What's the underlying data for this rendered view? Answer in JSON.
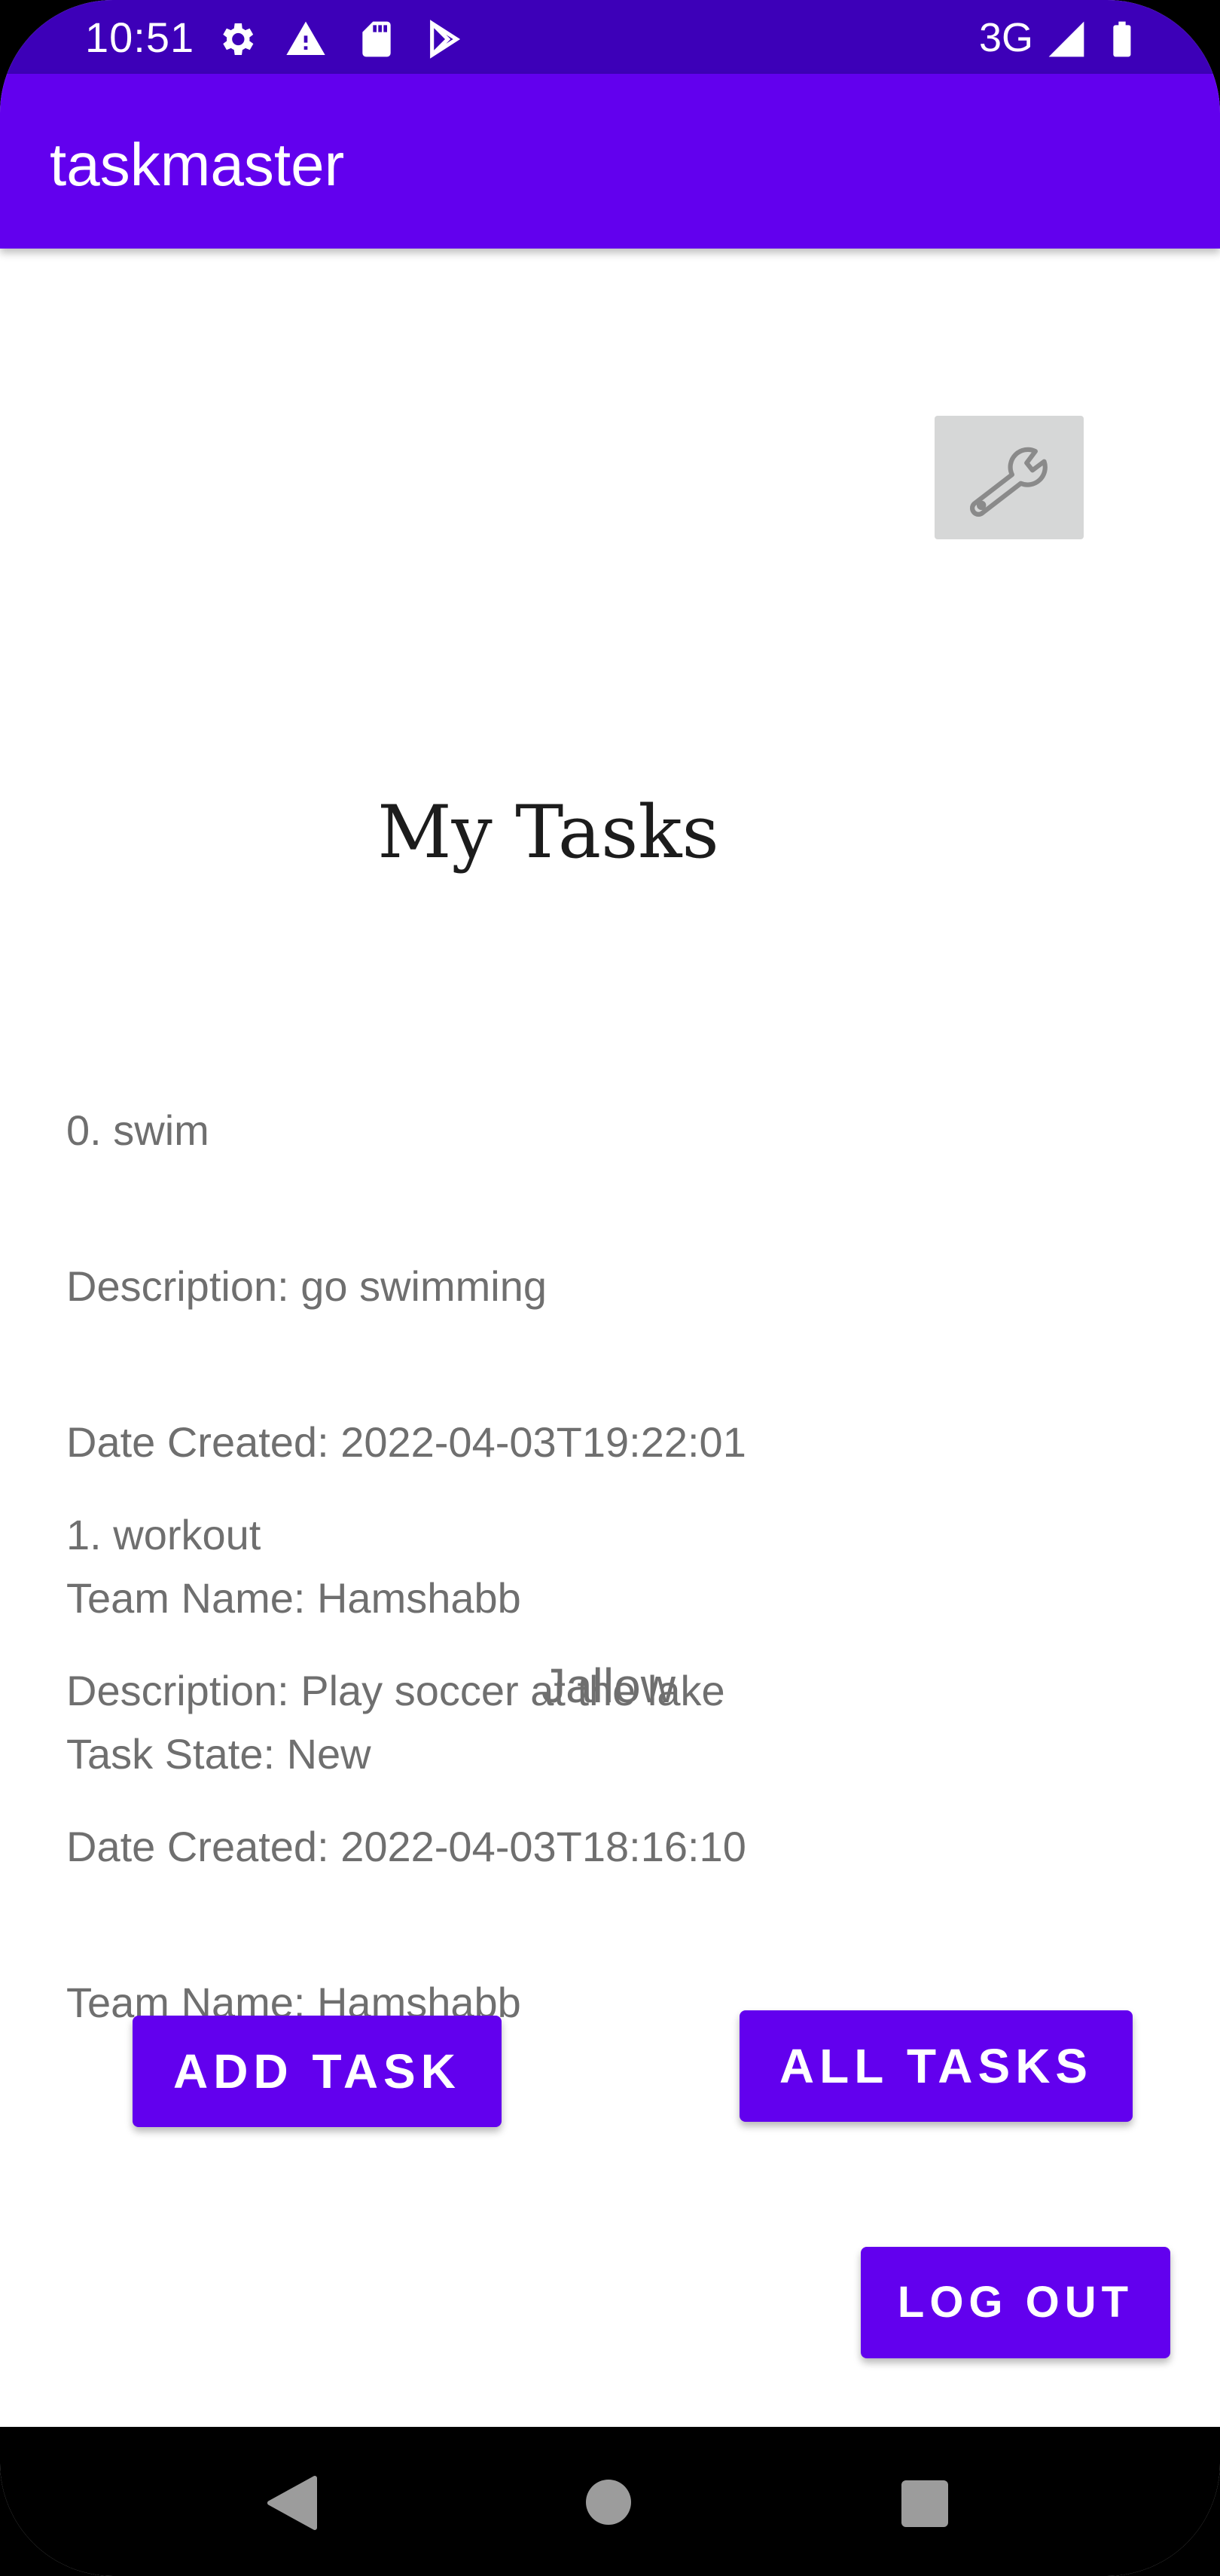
{
  "status_bar": {
    "time": "10:51",
    "network": "3G",
    "icons": [
      "settings-icon",
      "warning-icon",
      "sd-card-icon",
      "play-store-icon",
      "signal-icon",
      "battery-icon"
    ]
  },
  "app_bar": {
    "title": "taskmaster",
    "color": "#6200ee"
  },
  "settings": {
    "icon": "wrench-icon"
  },
  "main": {
    "title": "My Tasks",
    "tasks": [
      {
        "title": "0. swim",
        "description": "Description: go swimming",
        "date": "Date Created: 2022-04-03T19:22:01",
        "team": "Team Name: Hamshabb",
        "state": "Task State: New"
      },
      {
        "title": "1. workout",
        "description": "Description: Play soccer at the lake",
        "date": "Date Created: 2022-04-03T18:16:10",
        "team": "Team Name: Hamshabb"
      }
    ],
    "footer_text": "Jallow"
  },
  "buttons": {
    "add_task": "ADD TASK",
    "all_tasks": "ALL TASKS",
    "log_out": "LOG OUT"
  },
  "nav": {
    "back_icon": "back-icon",
    "home_icon": "home-icon",
    "recents_icon": "recents-icon"
  }
}
